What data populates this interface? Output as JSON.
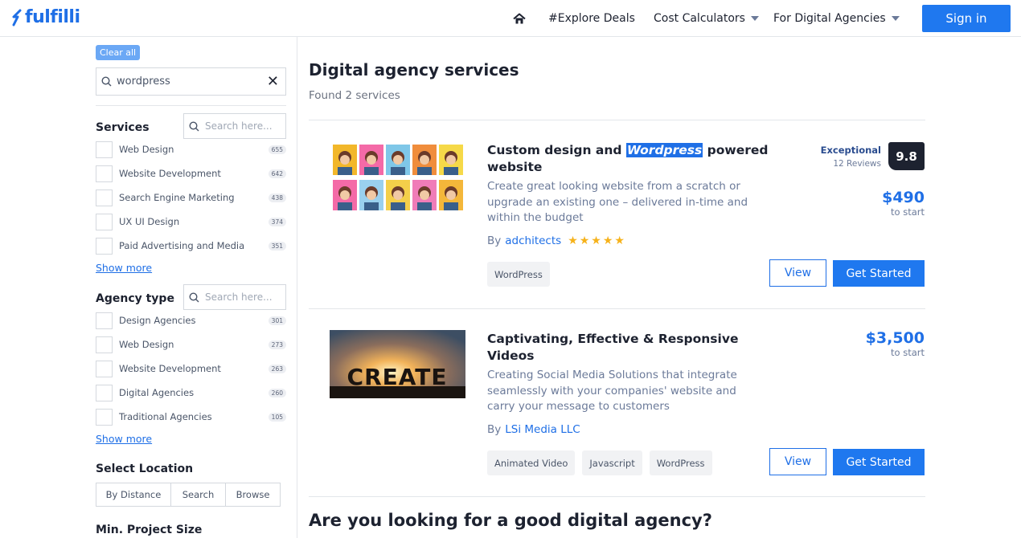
{
  "header": {
    "logo": "fulfilli",
    "nav": {
      "home_icon": "home-icon",
      "explore": "#Explore Deals",
      "calculators": "Cost Calculators",
      "agencies": "For Digital Agencies"
    },
    "signin": "Sign in"
  },
  "sidebar": {
    "clear_all": "Clear all",
    "search_value": "wordpress",
    "services": {
      "title": "Services",
      "search_placeholder": "Search here...",
      "items": [
        {
          "label": "Web Design",
          "count": "655"
        },
        {
          "label": "Website Development",
          "count": "642"
        },
        {
          "label": "Search Engine Marketing",
          "count": "438"
        },
        {
          "label": "UX UI Design",
          "count": "374"
        },
        {
          "label": "Paid Advertising and Media",
          "count": "351"
        }
      ],
      "show_more": "Show more"
    },
    "agency_type": {
      "title": "Agency type",
      "search_placeholder": "Search here...",
      "items": [
        {
          "label": "Design Agencies",
          "count": "301"
        },
        {
          "label": "Web Design",
          "count": "273"
        },
        {
          "label": "Website Development",
          "count": "263"
        },
        {
          "label": "Digital Agencies",
          "count": "260"
        },
        {
          "label": "Traditional Agencies",
          "count": "105"
        }
      ],
      "show_more": "Show more"
    },
    "location": {
      "title": "Select Location",
      "tabs": [
        "By Distance",
        "Search",
        "Browse"
      ]
    },
    "min_project": "Min. Project Size"
  },
  "main": {
    "title": "Digital agency services",
    "found": "Found 2 services",
    "cards": [
      {
        "title_before": "Custom design and ",
        "title_highlight": "Wordpress",
        "title_after": " powered website",
        "description": "Create great looking website from a scratch or upgrade an existing one – delivered in-time and within the budget",
        "by": "By",
        "vendor": "adchitects",
        "stars": "★★★★★",
        "rating_label": "Exceptional",
        "reviews": "12 Reviews",
        "score": "9.8",
        "price": "$490",
        "price_sub": "to start",
        "tags": [
          "WordPress"
        ],
        "view": "View",
        "get_started": "Get Started"
      },
      {
        "title": "Captivating, Effective & Responsive Videos",
        "description": "Creating Social Media Solutions that integrate seamlessly with your companies' website and carry your message to customers",
        "by": "By",
        "vendor": "LSi Media LLC",
        "price": "$3,500",
        "price_sub": "to start",
        "image_text": "CREATE",
        "tags": [
          "Animated Video",
          "Javascript",
          "WordPress"
        ],
        "view": "View",
        "get_started": "Get Started"
      }
    ],
    "bottom_heading": "Are you looking for a good digital agency?"
  }
}
